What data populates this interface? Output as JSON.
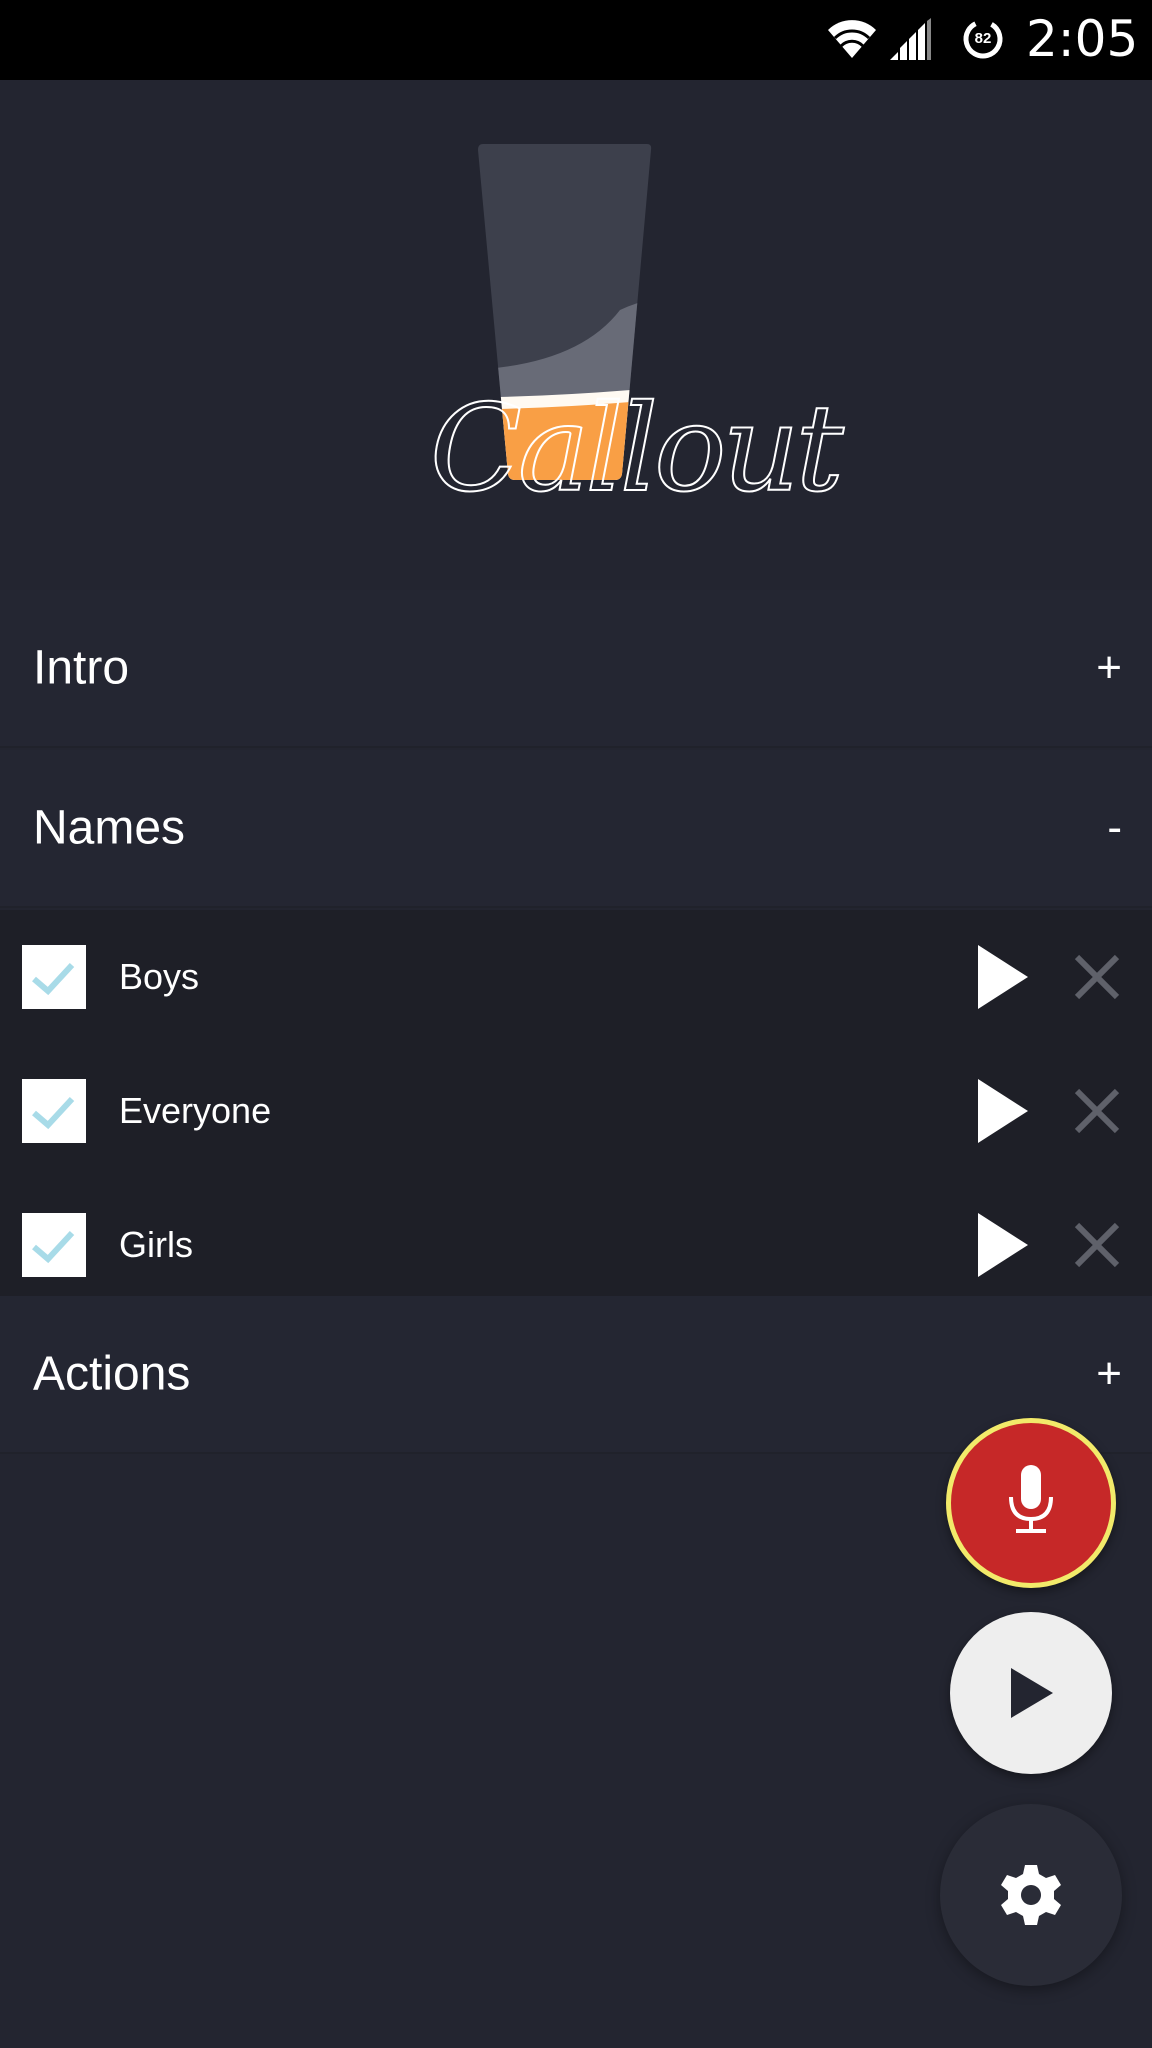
{
  "status_bar": {
    "battery_level": "82",
    "clock": "2:05",
    "icons": [
      "wifi-icon",
      "cell-signal-icon",
      "battery-icon"
    ]
  },
  "app": {
    "name": "Callout",
    "colors": {
      "background": "#232530",
      "list_background": "#1e1f27",
      "accent_orange": "#f99f45",
      "mic_red": "#c62828",
      "mic_ring": "#f2ea6a",
      "check_color": "#a8dbe8"
    }
  },
  "sections": {
    "intro": {
      "title": "Intro",
      "toggle": "+"
    },
    "names": {
      "title": "Names",
      "toggle": "-"
    },
    "actions": {
      "title": "Actions",
      "toggle": "+"
    }
  },
  "names_list": [
    {
      "label": "Boys",
      "checked": true
    },
    {
      "label": "Everyone",
      "checked": true
    },
    {
      "label": "Girls",
      "checked": true
    }
  ],
  "fabs": {
    "mic": "microphone-icon",
    "play": "play-icon",
    "settings": "gear-icon"
  }
}
